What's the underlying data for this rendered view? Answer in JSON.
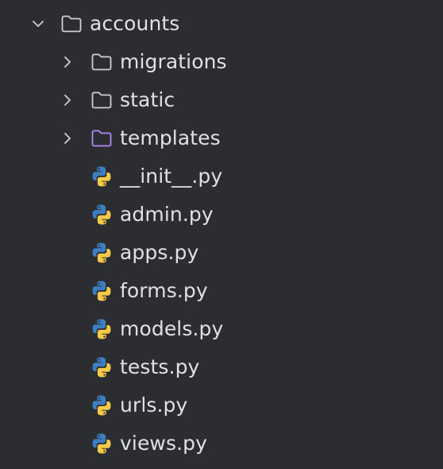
{
  "colors": {
    "background": "#2b2d30",
    "text": "#dfe1e5",
    "folder_default": "#ced0d6",
    "folder_templates": "#b189f5",
    "python_blue": "#3c7ebf",
    "python_yellow": "#f7c948"
  },
  "tree": {
    "root": {
      "label": "accounts",
      "icon": "folder-icon",
      "expanded": true
    },
    "folders": [
      {
        "label": "migrations",
        "icon": "folder-icon",
        "expanded": false
      },
      {
        "label": "static",
        "icon": "folder-icon",
        "expanded": false
      },
      {
        "label": "templates",
        "icon": "templates-folder-icon",
        "expanded": false
      }
    ],
    "files": [
      {
        "label": "__init__.py",
        "icon": "python-file-icon"
      },
      {
        "label": "admin.py",
        "icon": "python-file-icon"
      },
      {
        "label": "apps.py",
        "icon": "python-file-icon"
      },
      {
        "label": "forms.py",
        "icon": "python-file-icon"
      },
      {
        "label": "models.py",
        "icon": "python-file-icon"
      },
      {
        "label": "tests.py",
        "icon": "python-file-icon"
      },
      {
        "label": "urls.py",
        "icon": "python-file-icon"
      },
      {
        "label": "views.py",
        "icon": "python-file-icon"
      }
    ]
  }
}
